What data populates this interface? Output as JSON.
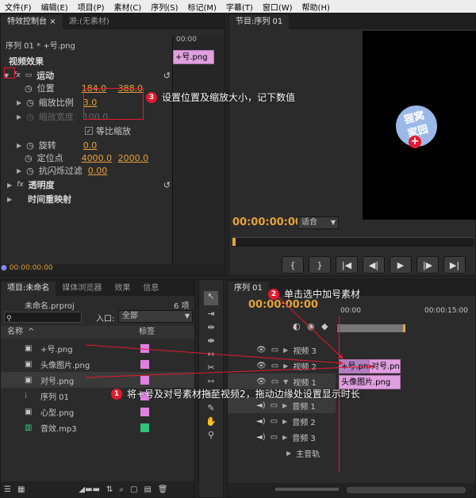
{
  "menu": [
    "文件(F)",
    "编辑(E)",
    "项目(P)",
    "素材(C)",
    "序列(S)",
    "标记(M)",
    "字幕(T)",
    "窗口(W)",
    "帮助(H)"
  ],
  "effect_panel": {
    "tab_active": "特效控制台",
    "tab_close": "×",
    "tab_inactive": "源:(无素材)",
    "clip_title": "序列 01 * +号.png",
    "mini_time": "00:00",
    "mini_clip": "+号.png",
    "video_effects": "视频效果",
    "motion": "运动",
    "position_label": "位置",
    "position_x": "184.0",
    "position_y": "388.0",
    "scale_label": "缩放比例",
    "scale_value": "3.0",
    "scale_width_label": "缩放宽度",
    "scale_width_value": "100.0",
    "uniform_scale": "等比缩放",
    "rotation_label": "旋转",
    "rotation_value": "0.0",
    "anchor_label": "定位点",
    "anchor_x": "4000.0",
    "anchor_y": "2000.0",
    "antiflicker_label": "抗闪烁过滤",
    "antiflicker_value": "0.00",
    "opacity": "透明度",
    "time_remap": "时间重映射",
    "timecode": "00:00:00:00"
  },
  "program_panel": {
    "tab": "节目:序列 01",
    "timecode": "00:00:00:00",
    "fit": "适合",
    "watermark_line1": "狸窝",
    "watermark_line2": "家园"
  },
  "project_panel": {
    "tabs": [
      "项目:未命名",
      "媒体浏览器",
      "效果",
      "信息"
    ],
    "project_file": "未命名.prproj",
    "item_count": "6 项",
    "search_placeholder": "",
    "entry_label": "入口:",
    "entry_value": "全部",
    "col_name": "名称",
    "col_label": "标签",
    "items": [
      {
        "name": "+号.png",
        "color": "#e080e0"
      },
      {
        "name": "头像图片.png",
        "color": "#e080e0"
      },
      {
        "name": "对号.png",
        "color": "#e080e0"
      },
      {
        "name": "序列 01",
        "color": "#e080e0"
      },
      {
        "name": "心型.png",
        "color": "#e080e0"
      },
      {
        "name": "音效.mp3",
        "color": "#30c080"
      }
    ]
  },
  "timeline": {
    "tab": "序列 01",
    "timecode": "00:00:00:00",
    "ruler_start": "00:00",
    "ruler_mid": "00:00:15:00",
    "tracks": [
      "视频 3",
      "视频 2",
      "视频 1",
      "音频 1",
      "音频 2",
      "音频 3",
      "主音轨"
    ],
    "clips": {
      "v2_a": "+号.png",
      "v2_b": "对号.pn",
      "v1": "头像图片.png"
    }
  },
  "annotations": {
    "a1_num": "1",
    "a1_text": "将+号及对号素材拖至视频2，拖动边缘处设置显示时长",
    "a2_num": "2",
    "a2_text": "单击选中加号素材",
    "a3_num": "3",
    "a3_text": "设置位置及缩放大小，记下数值"
  },
  "colors": {
    "accent": "#e8a23a",
    "callout": "#e5192e",
    "clip": "#e0a0e0"
  }
}
